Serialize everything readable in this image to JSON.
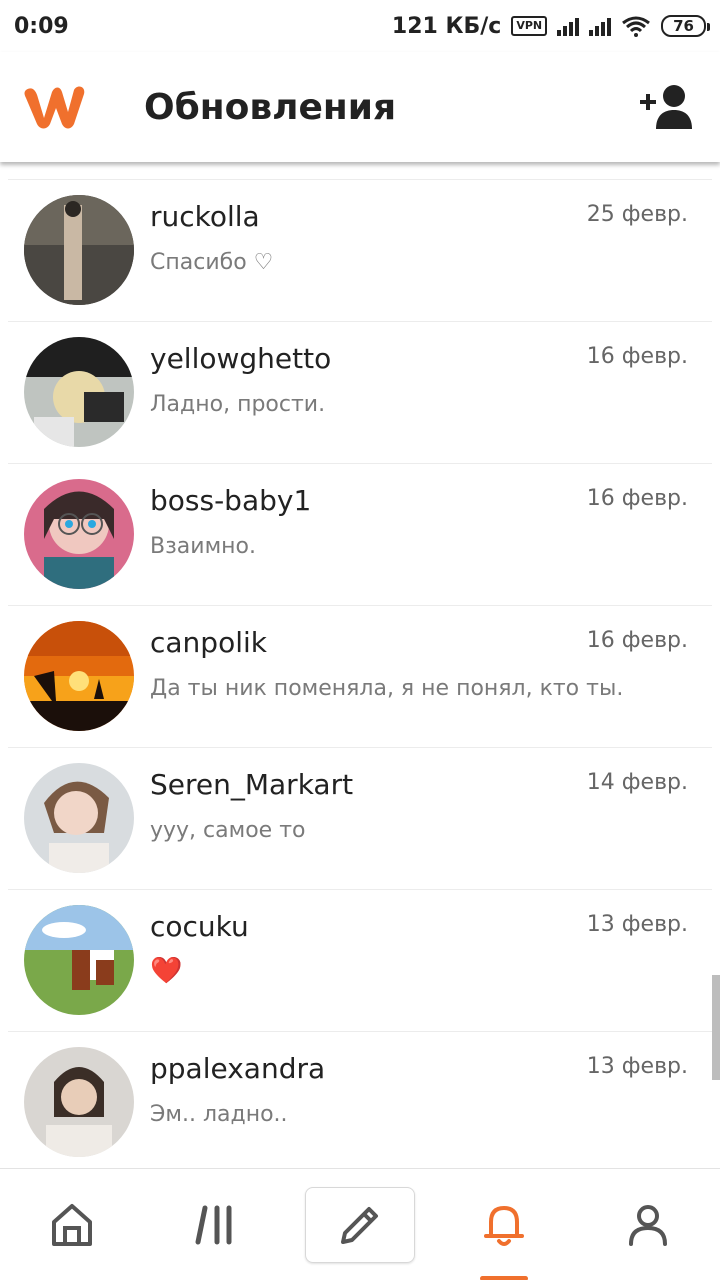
{
  "status_bar": {
    "time": "0:09",
    "speed": "121 КБ/с",
    "vpn": "VPN",
    "battery": "76"
  },
  "header": {
    "title": "Обновления",
    "logo_icon": "wattpad-logo",
    "action_icon": "add-user-icon",
    "brand_color": "#f0702d"
  },
  "messages": [
    {
      "name": "ruckolla",
      "date": "25 февр.",
      "text": "Спасибо ♡"
    },
    {
      "name": "yellowghetto",
      "date": "16 февр.",
      "text": "Ладно, прости."
    },
    {
      "name": "boss-baby1",
      "date": "16 февр.",
      "text": "Взаимно."
    },
    {
      "name": "canpolik",
      "date": "16 февр.",
      "text": "Да ты ник поменяла, я не понял, кто ты."
    },
    {
      "name": "Seren_Markart",
      "date": "14 февр.",
      "text": "ууу, самое то"
    },
    {
      "name": "cocuku",
      "date": "13 февр.",
      "text": "❤️"
    },
    {
      "name": "ppalexandra",
      "date": "13 февр.",
      "text": "Эм.. ладно.."
    }
  ],
  "bottom_nav": {
    "items": [
      "home-icon",
      "library-icon",
      "write-icon",
      "notifications-icon",
      "profile-icon"
    ],
    "active": "notifications-icon"
  }
}
